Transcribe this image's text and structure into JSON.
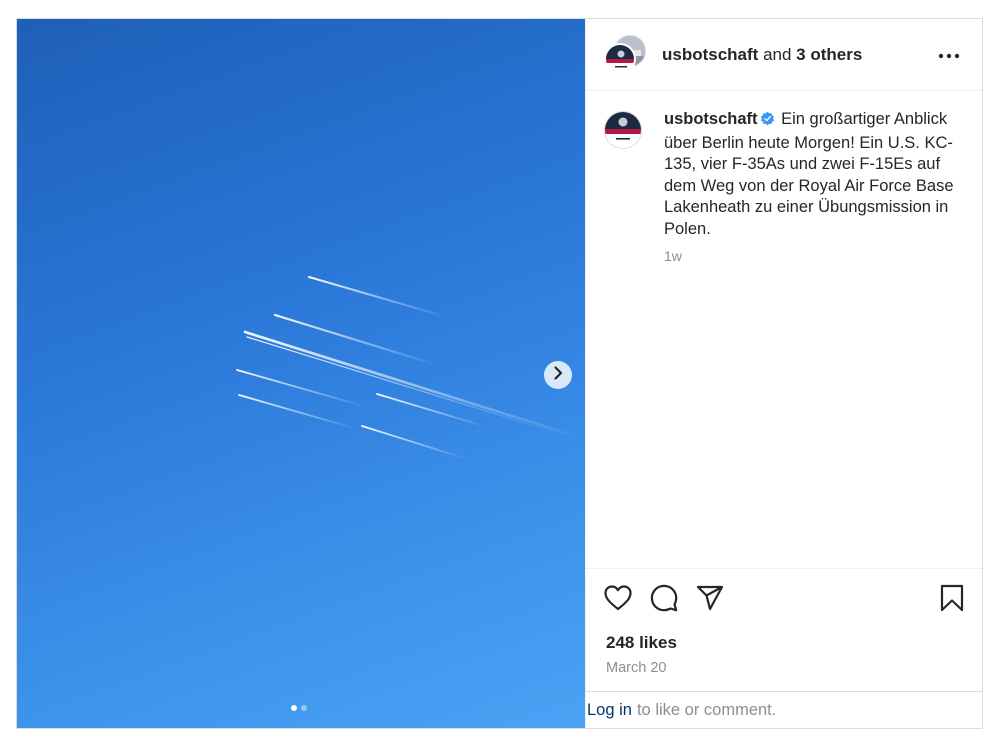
{
  "header": {
    "username": "usbotschaft",
    "and_text": " and ",
    "others": "3 others"
  },
  "caption": {
    "username": "usbotschaft",
    "text": "Ein großartiger Anblick über Berlin heute Morgen! Ein U.S. KC-135, vier F-35As und zwei F-15Es auf dem Weg von der Royal Air Force Base Lakenheath zu einer Übungsmission in Polen.",
    "time": "1w"
  },
  "stats": {
    "likes": "248 likes",
    "date": "March 20"
  },
  "login_bar": {
    "link": "Log in",
    "text": "to like or comment."
  },
  "carousel": {
    "slide_count": 2,
    "active_index": 0
  },
  "icons": {
    "next": "chevron-right-icon",
    "more": "more-dots-icon",
    "like": "heart-icon",
    "comment": "comment-bubble-icon",
    "share": "paper-plane-icon",
    "save": "bookmark-icon",
    "verified": "verified-badge-icon"
  },
  "colors": {
    "sky": "#2a77d8",
    "verified": "#3897f0",
    "link": "#00376b",
    "muted": "#8e8e8e"
  }
}
